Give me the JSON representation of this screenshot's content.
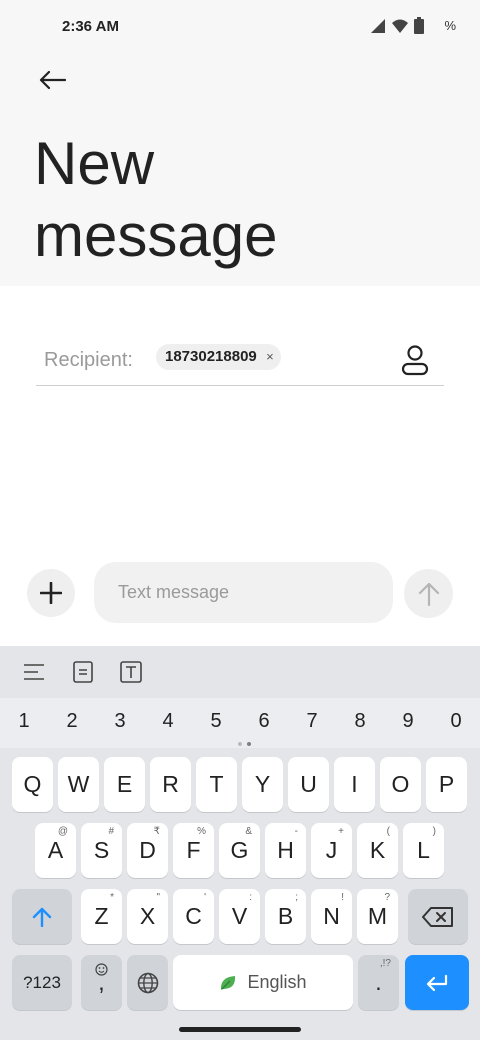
{
  "status_bar": {
    "time": "2:36 AM",
    "battery_text": "%"
  },
  "header": {
    "title_line1": "New",
    "title_line2": "message"
  },
  "recipient": {
    "label": "Recipient:",
    "chip_number": "18730218809",
    "chip_remove": "×"
  },
  "compose": {
    "placeholder": "Text message"
  },
  "keyboard": {
    "numbers": [
      "1",
      "2",
      "3",
      "4",
      "5",
      "6",
      "7",
      "8",
      "9",
      "0"
    ],
    "row1": [
      {
        "k": "Q",
        "h": ""
      },
      {
        "k": "W",
        "h": ""
      },
      {
        "k": "E",
        "h": ""
      },
      {
        "k": "R",
        "h": ""
      },
      {
        "k": "T",
        "h": ""
      },
      {
        "k": "Y",
        "h": ""
      },
      {
        "k": "U",
        "h": ""
      },
      {
        "k": "I",
        "h": ""
      },
      {
        "k": "O",
        "h": ""
      },
      {
        "k": "P",
        "h": ""
      }
    ],
    "row2": [
      {
        "k": "A",
        "h": "@"
      },
      {
        "k": "S",
        "h": "#"
      },
      {
        "k": "D",
        "h": "₹"
      },
      {
        "k": "F",
        "h": "%"
      },
      {
        "k": "G",
        "h": "&"
      },
      {
        "k": "H",
        "h": "-"
      },
      {
        "k": "J",
        "h": "+"
      },
      {
        "k": "K",
        "h": "("
      },
      {
        "k": "L",
        "h": ")"
      }
    ],
    "row3": [
      {
        "k": "Z",
        "h": "*"
      },
      {
        "k": "X",
        "h": "\""
      },
      {
        "k": "C",
        "h": "'"
      },
      {
        "k": "V",
        "h": ":"
      },
      {
        "k": "B",
        "h": ";"
      },
      {
        "k": "N",
        "h": "!"
      },
      {
        "k": "M",
        "h": "?"
      }
    ],
    "symbols_key": "?123",
    "comma_key": ",",
    "period_key": ".",
    "period_hint": ",!?",
    "space_label": "English"
  },
  "colors": {
    "accent": "#1e8fff",
    "keyboard_bg": "#e3e5e8",
    "leaf": "#4caf50"
  }
}
